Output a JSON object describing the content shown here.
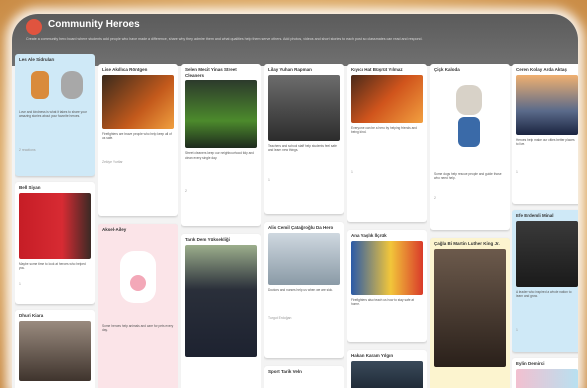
{
  "board": {
    "title": "Community Heroes",
    "description": "Create a community hero board where students add people who have made a difference, share why they admire them and what qualities help them serve others. Add photos, videos and short stories to each post so classmates can read and respond.",
    "accent": "#e0543f"
  },
  "cards": [
    {
      "id": "c1",
      "title": "Les Ale Sidruları",
      "color": "blue",
      "img": "cookies",
      "body": "Love and kindness is what it takes to share your amazing stories about your favorite heroes.",
      "meta": "2 reactions"
    },
    {
      "id": "c2",
      "title": "Bell Siyan",
      "color": "white",
      "img": "flag",
      "body": "Maybe some time to look at heroes who helped you.",
      "meta": "1"
    },
    {
      "id": "c3",
      "title": "Dhuri Kiara",
      "color": "white",
      "img": "mlk",
      "body": "",
      "meta": ""
    },
    {
      "id": "c4",
      "title": "Lise Akıllıca Röntgen",
      "color": "white",
      "img": "fire",
      "body": "Firefighters are brave people who help keep all of us safe.",
      "meta": "Zekiye Yurtlar"
    },
    {
      "id": "c5",
      "title": "Aksel-Ailey",
      "color": "pink",
      "img": "paw",
      "body": "Some heroes help animals and care for pets every day.",
      "meta": ""
    },
    {
      "id": "c6",
      "title": "Selen Mecit Yinas Street Cleaners",
      "color": "white",
      "img": "worker",
      "body": "Street cleaners keep our neighbourhood tidy and clean every single day.",
      "meta": "2"
    },
    {
      "id": "c7",
      "title": "Tarık Dem Yüksekliği",
      "color": "white",
      "img": "police",
      "body": "",
      "meta": ""
    },
    {
      "id": "c8",
      "title": "Lilay Yuhan Rapman",
      "color": "white",
      "img": "cat",
      "body": "Teachers and school staff help students feel safe and learn new things.",
      "meta": "1"
    },
    {
      "id": "c9",
      "title": "Alis Cemil Çatağroğlu Da Hero",
      "color": "white",
      "img": "doctor",
      "body": "Doctors and nurses help us when we are sick.",
      "meta": "Turgut Erdoğan"
    },
    {
      "id": "c10",
      "title": "Sport Tarik Veln",
      "color": "white",
      "img": "news",
      "body": "",
      "meta": ""
    },
    {
      "id": "c11",
      "title": "Kıyıcı Hat Büşrüt Yılmaz",
      "color": "white",
      "img": "firestreet",
      "body": "Everyone can be a hero by helping friends and being kind.",
      "meta": "1"
    },
    {
      "id": "c12",
      "title": "Ana Yaşlık İlçrük",
      "color": "white",
      "img": "fireman",
      "body": "Firefighters also teach us how to stay safe at home.",
      "meta": ""
    },
    {
      "id": "c13",
      "title": "Hakan Karam Yılgın",
      "color": "white",
      "img": "crowd",
      "body": "",
      "meta": ""
    },
    {
      "id": "c14",
      "title": "Çiçk Kaloda",
      "color": "white",
      "img": "dog",
      "body": "Some dogs help rescue people and guide those who need help.",
      "meta": "2"
    },
    {
      "id": "c15",
      "title": "Çağla Bi Martin Luther King Jr.",
      "color": "yellow",
      "img": "mlk2",
      "body": "",
      "meta": ""
    },
    {
      "id": "c16",
      "title": "Ceren Kolay Arda Aktaş",
      "color": "white",
      "img": "city",
      "body": "Heroes help make our cities better places to live.",
      "meta": "1"
    },
    {
      "id": "c17",
      "title": "Efe Erdemli Minal",
      "color": "white",
      "img": "ataturk",
      "body": "A leader who inspired a whole nation to learn and grow.",
      "meta": "1"
    },
    {
      "id": "c18",
      "title": "Eylin Demirci",
      "color": "white",
      "img": "flowers",
      "body": "",
      "meta": ""
    }
  ]
}
